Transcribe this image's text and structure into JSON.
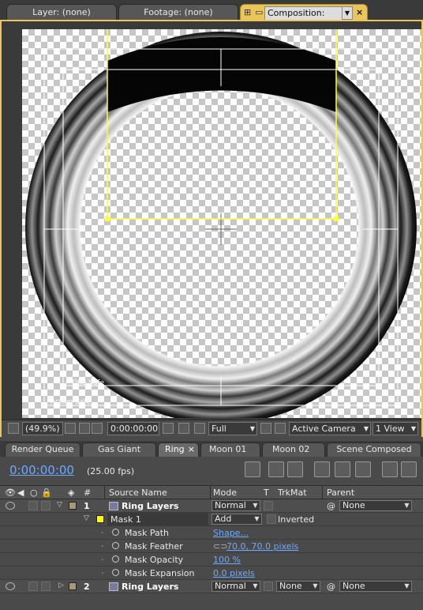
{
  "viewer_tabs": [
    {
      "label": "Layer: (none)"
    },
    {
      "label": "Footage: (none)"
    },
    {
      "label": "Composition: Ring"
    }
  ],
  "composition": {
    "name": "Ring",
    "title_safe_label": "Title Safe",
    "action_safe_label": "Action Safe",
    "mask_color": "#ffff3c"
  },
  "viewer_toolbar": {
    "magnification": "(49.9%)",
    "timecode": "0:00:00:00",
    "resolution": "Full",
    "camera": "Active Camera",
    "view_layout": "1 View"
  },
  "timeline_tabs": [
    {
      "label": "Render Queue"
    },
    {
      "label": "Gas Giant"
    },
    {
      "label": "Ring"
    },
    {
      "label": "Moon 01"
    },
    {
      "label": "Moon 02"
    },
    {
      "label": "Scene Composed"
    }
  ],
  "timeline": {
    "current_time": "0:00:00:00",
    "fps": "(25.00 fps)"
  },
  "columns": {
    "number": "#",
    "source_name": "Source Name",
    "mode": "Mode",
    "t": "T",
    "trkmat": "TrkMat",
    "parent": "Parent"
  },
  "layers": [
    {
      "number": "1",
      "name": "Ring Layers",
      "mode": "Normal",
      "trkmat": "",
      "parent": "None",
      "label_color": "#a89878"
    },
    {
      "number": "2",
      "name": "Ring Layers",
      "mode": "Normal",
      "trkmat": "None",
      "parent": "None",
      "label_color": "#a89878"
    }
  ],
  "mask": {
    "name": "Mask 1",
    "mode": "Add",
    "inverted_label": "Inverted",
    "color": "#ffff00",
    "properties": [
      {
        "name": "Mask Path",
        "value": "Shape..."
      },
      {
        "name": "Mask Feather",
        "value": "70.0, 70.0 pixels"
      },
      {
        "name": "Mask Opacity",
        "value": "100 %"
      },
      {
        "name": "Mask Expansion",
        "value": "0.0 pixels"
      }
    ]
  }
}
